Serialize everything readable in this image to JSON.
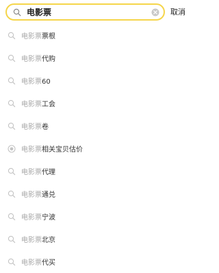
{
  "search": {
    "value": "电影票",
    "cancel_label": "取消"
  },
  "suggestions": [
    {
      "match": "电影票",
      "rest": "票根",
      "icon": "search-icon"
    },
    {
      "match": "电影票",
      "rest": "代购",
      "icon": "search-icon"
    },
    {
      "match": "电影票",
      "rest": "60",
      "icon": "search-icon"
    },
    {
      "match": "电影票",
      "rest": "工会",
      "icon": "search-icon"
    },
    {
      "match": "电影票",
      "rest": "卷",
      "icon": "search-icon"
    },
    {
      "match": "电影票",
      "rest": "相关宝贝估价",
      "icon": "price-estimate-icon"
    },
    {
      "match": "电影票",
      "rest": "代理",
      "icon": "search-icon"
    },
    {
      "match": "电影票",
      "rest": "通兑",
      "icon": "search-icon"
    },
    {
      "match": "电影票",
      "rest": "宁波",
      "icon": "search-icon"
    },
    {
      "match": "电影票",
      "rest": "北京",
      "icon": "search-icon"
    },
    {
      "match": "电影票",
      "rest": "代买",
      "icon": "search-icon"
    }
  ]
}
